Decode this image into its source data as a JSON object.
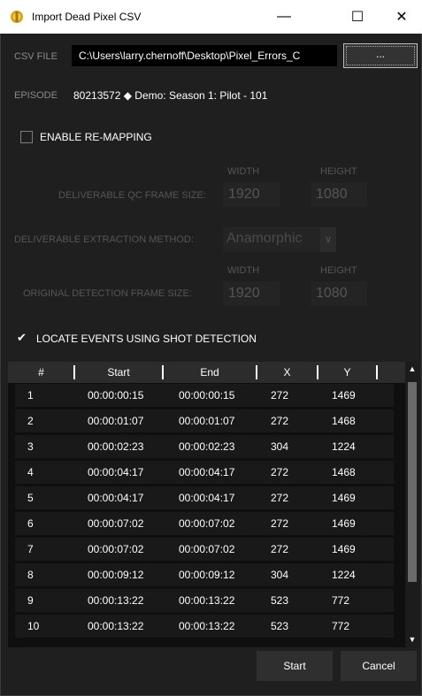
{
  "window": {
    "title": "Import Dead Pixel CSV",
    "minimize": "—",
    "maximize": "☐",
    "close": "✕",
    "icon": "app-icon"
  },
  "csv": {
    "label": "CSV FILE",
    "path": "C:\\Users\\larry.chernoff\\Desktop\\Pixel_Errors_C",
    "browse_label": "..."
  },
  "episode": {
    "label": "EPISODE",
    "value": "80213572 ◆ Demo: Season 1: Pilot - 101"
  },
  "remap": {
    "label": "ENABLE RE-MAPPING",
    "checked": false
  },
  "qc_frame": {
    "label": "DELIVERABLE QC FRAME SIZE:",
    "width_header": "WIDTH",
    "height_header": "HEIGHT",
    "width": "1920",
    "height": "1080"
  },
  "extraction": {
    "label": "DELIVERABLE EXTRACTION METHOD:",
    "value": "Anamorphic"
  },
  "original_frame": {
    "label": "ORIGINAL DETECTION FRAME SIZE:",
    "width_header": "WIDTH",
    "height_header": "HEIGHT",
    "width": "1920",
    "height": "1080"
  },
  "shot_detection": {
    "label": "LOCATE EVENTS USING SHOT DETECTION",
    "checked": true
  },
  "table": {
    "columns": [
      "#",
      "Start",
      "End",
      "X",
      "Y"
    ],
    "rows": [
      [
        "1",
        "00:00:00:15",
        "00:00:00:15",
        "272",
        "1469"
      ],
      [
        "2",
        "00:00:01:07",
        "00:00:01:07",
        "272",
        "1468"
      ],
      [
        "3",
        "00:00:02:23",
        "00:00:02:23",
        "304",
        "1224"
      ],
      [
        "4",
        "00:00:04:17",
        "00:00:04:17",
        "272",
        "1468"
      ],
      [
        "5",
        "00:00:04:17",
        "00:00:04:17",
        "272",
        "1469"
      ],
      [
        "6",
        "00:00:07:02",
        "00:00:07:02",
        "272",
        "1469"
      ],
      [
        "7",
        "00:00:07:02",
        "00:00:07:02",
        "272",
        "1469"
      ],
      [
        "8",
        "00:00:09:12",
        "00:00:09:12",
        "304",
        "1224"
      ],
      [
        "9",
        "00:00:13:22",
        "00:00:13:22",
        "523",
        "772"
      ],
      [
        "10",
        "00:00:13:22",
        "00:00:13:22",
        "523",
        "772"
      ]
    ]
  },
  "buttons": {
    "start": "Start",
    "cancel": "Cancel"
  },
  "colors": {
    "background": "#1f1f1f",
    "table_background": "#0f0f0f",
    "header_background": "#2c2c2c",
    "muted_label": "#8a8a8a"
  }
}
